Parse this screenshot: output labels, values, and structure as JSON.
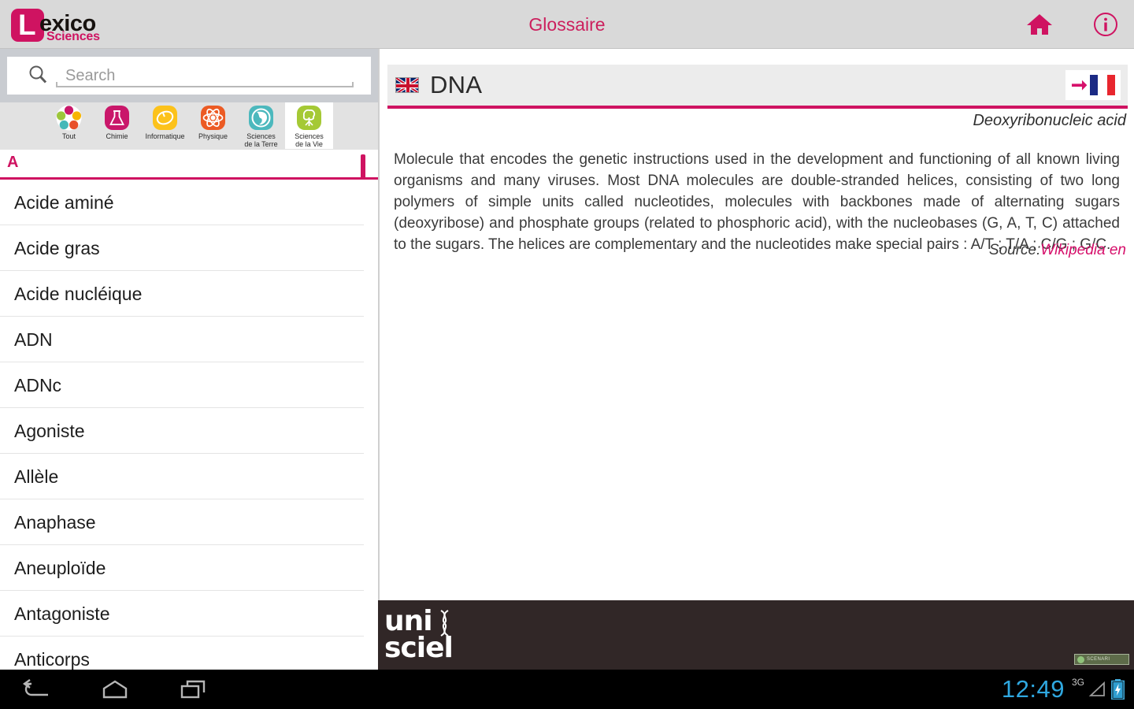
{
  "app": {
    "logo": {
      "letter": "L",
      "name": "exico",
      "tagline": "Sciences"
    },
    "title": "Glossaire",
    "icons": {
      "home": "home-icon",
      "info": "info-icon"
    }
  },
  "search": {
    "placeholder": "Search",
    "value": "",
    "icon": "search-icon"
  },
  "categories": [
    {
      "label": "Tout",
      "icon": "all-disciplines-icon",
      "active": false
    },
    {
      "label": "Chimie",
      "icon": "flask-icon",
      "active": false
    },
    {
      "label": "Informatique",
      "icon": "mouse-icon",
      "active": false
    },
    {
      "label": "Physique",
      "icon": "atom-icon",
      "active": false
    },
    {
      "label": "Sciences\nde la Terre",
      "icon": "globe-icon",
      "active": false
    },
    {
      "label": "Sciences\nde la Vie",
      "icon": "tree-icon",
      "active": true
    }
  ],
  "list": {
    "section_letter": "A",
    "items": [
      "Acide aminé",
      "Acide gras",
      "Acide nucléique",
      "ADN",
      "ADNc",
      "Agoniste",
      "Allèle",
      "Anaphase",
      "Aneuploïde",
      "Antagoniste",
      "Anticorps"
    ]
  },
  "entry": {
    "flag": "uk-flag-icon",
    "title": "DNA",
    "translate_button": "translate-to-french-button",
    "subtitle": "Deoxyribonucleic acid",
    "definition": "Molecule that encodes the genetic instructions used in the development and functioning of all known living organisms and many viruses. Most DNA molecules are double-stranded helices, consisting of two long polymers of simple units called nucleotides, molecules with backbones made of alternating sugars (deoxyribose) and phosphate groups (related to phosphoric acid), with the nucleobases (G, A, T, C) attached to the sugars. The helices are complementary and the nucleotides make special pairs : A/T ; T/A ; C/G ; G/C.",
    "source_label": "Source:",
    "source_link": "Wikipedia en"
  },
  "footer": {
    "logo_line1": "uni",
    "logo_line2": "sciel",
    "badge_text": "SCENARI"
  },
  "statusbar": {
    "clock": "12:49",
    "network": "3G",
    "icons": {
      "back": "back-icon",
      "home": "home-icon",
      "recents": "recents-icon",
      "signal": "signal-icon",
      "battery": "battery-charging-icon"
    }
  },
  "colors": {
    "accent": "#cf1361",
    "title": "#cc1f5d",
    "clock": "#2fa8e0",
    "footer_bg": "#312727"
  }
}
